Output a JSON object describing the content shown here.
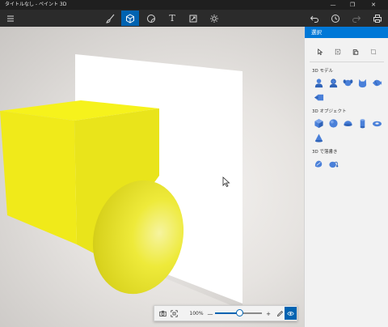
{
  "window": {
    "title": "タイトルなし - ペイント 3D",
    "minimize_glyph": "—",
    "maximize_glyph": "❐",
    "close_glyph": "✕"
  },
  "toolbar": {
    "menu_icon": "hamburger-icon",
    "tools": [
      {
        "name": "brushes-tool",
        "icon": "brush-icon"
      },
      {
        "name": "3d-shapes-tool",
        "icon": "cube-icon",
        "active": true
      },
      {
        "name": "stickers-tool",
        "icon": "sticker-icon"
      },
      {
        "name": "text-tool",
        "icon": "text-icon",
        "glyph": "T"
      },
      {
        "name": "effects-tool",
        "icon": "resize-icon"
      },
      {
        "name": "canvas-tool",
        "icon": "sun-icon"
      }
    ],
    "right_tools": [
      {
        "name": "undo",
        "icon": "undo-icon"
      },
      {
        "name": "history",
        "icon": "history-icon"
      },
      {
        "name": "redo",
        "icon": "redo-icon"
      },
      {
        "name": "print",
        "icon": "print-icon"
      }
    ]
  },
  "panel": {
    "header": "選択",
    "section_models": "3D モデル",
    "section_objects": "3D オブジェクト",
    "section_doodle": "3D で落書き",
    "accent": "#0078d7"
  },
  "zoombar": {
    "zoom_percent": "100%",
    "minus_glyph": "—",
    "plus_glyph": "+",
    "zoom_level": 0.5
  },
  "colors": {
    "accent": "#0063b1",
    "shape_blue": "#4a80d9",
    "object_yellow": "#f2ef3c"
  }
}
